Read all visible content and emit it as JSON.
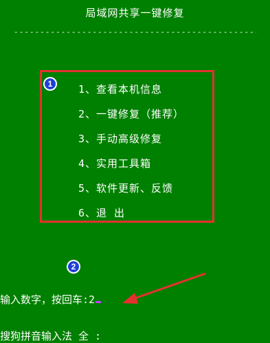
{
  "title": "局域网共享一键修复",
  "divider": "-----------------------------------------------------------",
  "menu": {
    "items": [
      {
        "label": "1、查看本机信息"
      },
      {
        "label": "2、一键修复（推荐）"
      },
      {
        "label": "3、手动高级修复"
      },
      {
        "label": "4、实用工具箱"
      },
      {
        "label": "5、软件更新、反馈"
      },
      {
        "label": "6、退  出"
      }
    ]
  },
  "annotations": {
    "badge_1": "1",
    "badge_2": "2",
    "badge_color": "#1e3fd6",
    "box_color": "#e53030",
    "arrow_color": "#e53030"
  },
  "prompt": {
    "text": "输入数字，按回车:",
    "value": "2"
  },
  "ime_status": "搜狗拼音输入法 全 :"
}
